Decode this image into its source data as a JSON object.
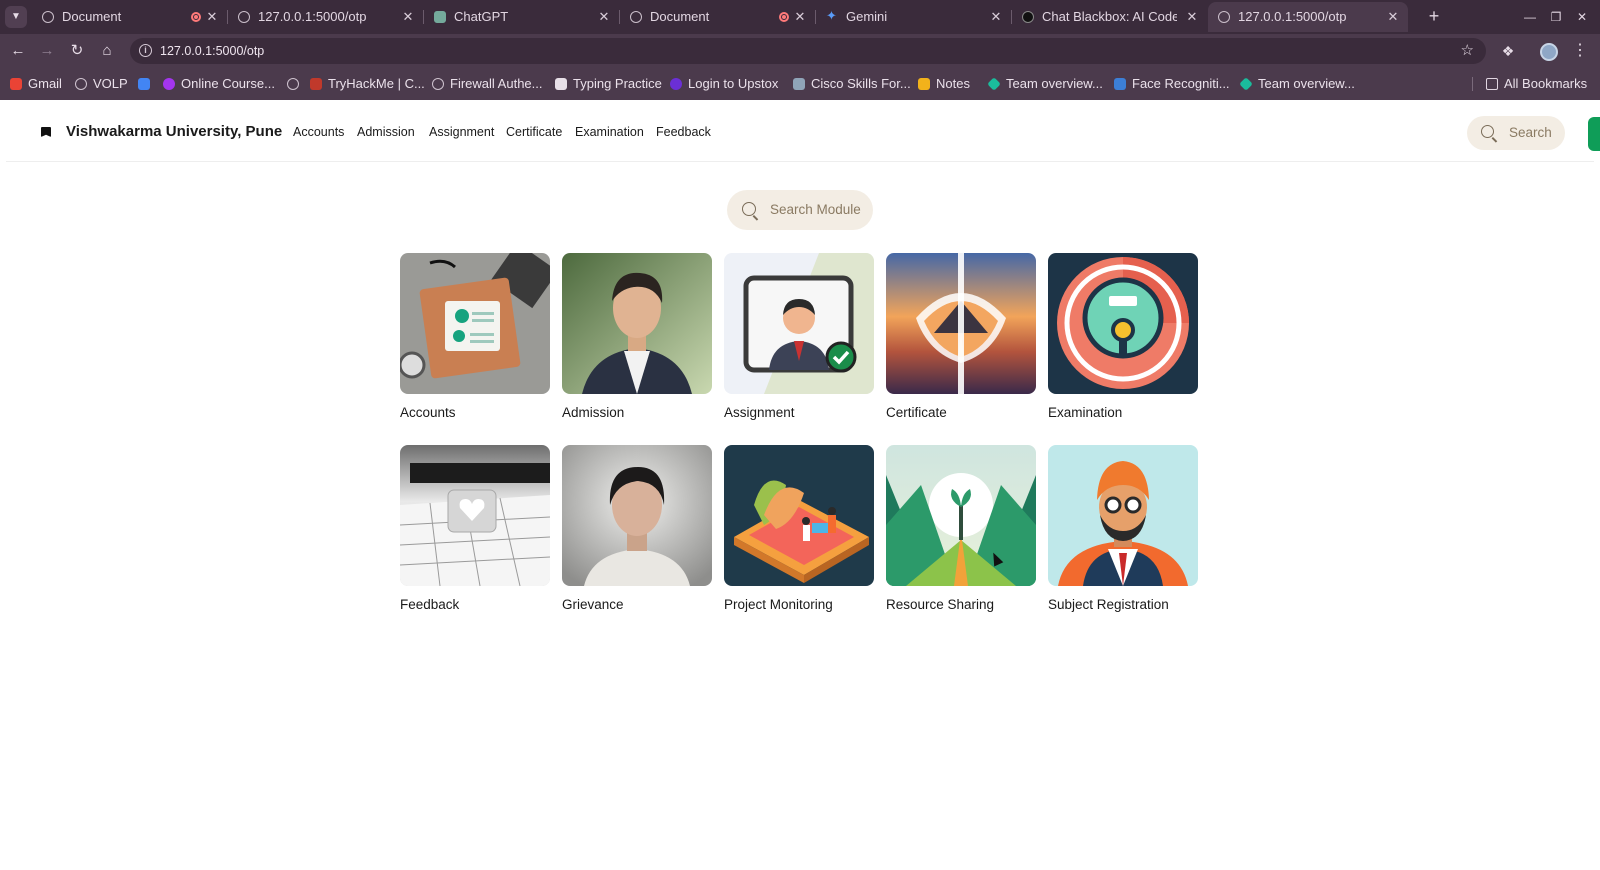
{
  "browser": {
    "tabs": [
      {
        "title": "Document",
        "recording": true
      },
      {
        "title": "127.0.0.1:5000/otp",
        "recording": false
      },
      {
        "title": "ChatGPT",
        "recording": false
      },
      {
        "title": "Document",
        "recording": true
      },
      {
        "title": "Gemini",
        "recording": false
      },
      {
        "title": "Chat Blackbox: AI Code G",
        "recording": false
      },
      {
        "title": "127.0.0.1:5000/otp",
        "recording": false,
        "active": true
      }
    ],
    "new_tab_label": "+",
    "address": "127.0.0.1:5000/otp",
    "bookmarks": [
      {
        "label": "Gmail",
        "icon": "gmail-icon",
        "color": "#ea4335"
      },
      {
        "label": "VOLP",
        "icon": "globe-icon",
        "color": "#cfc3cf"
      },
      {
        "label": "",
        "icon": "bookmark-icon",
        "color": "#4285f4"
      },
      {
        "label": "Online Course...",
        "icon": "udemy-icon",
        "color": "#a435f0"
      },
      {
        "label": "",
        "icon": "globe-icon",
        "color": "#cfc3cf"
      },
      {
        "label": "TryHackMe | C...",
        "icon": "tryhackme-icon",
        "color": "#c0392b"
      },
      {
        "label": "Firewall Authe...",
        "icon": "globe-icon",
        "color": "#cfc3cf"
      },
      {
        "label": "Typing Practice",
        "icon": "keyboard-icon",
        "color": "#e8e0e8"
      },
      {
        "label": "Login to Upstox",
        "icon": "upstox-icon",
        "color": "#6b2fd6"
      },
      {
        "label": "Cisco Skills For...",
        "icon": "cisco-icon",
        "color": "#8fa4b8"
      },
      {
        "label": "Notes",
        "icon": "notes-icon",
        "color": "#f2b21b"
      },
      {
        "label": "Team overview...",
        "icon": "diamond-icon",
        "color": "#1abc9c"
      },
      {
        "label": "Face Recogniti...",
        "icon": "face-recognition-icon",
        "color": "#3c7fd6"
      },
      {
        "label": "Team overview...",
        "icon": "diamond-icon",
        "color": "#1abc9c"
      }
    ],
    "all_bookmarks_label": "All Bookmarks"
  },
  "site": {
    "brand": "Vishwakarma University, Pune",
    "nav_links": [
      "Accounts",
      "Admission",
      "Assignment",
      "Certificate",
      "Examination",
      "Feedback"
    ],
    "search_label": "Search",
    "accent_color": "#0f9d58"
  },
  "main": {
    "search_placeholder": "Search Module",
    "modules": [
      {
        "label": "Accounts",
        "image": "accounts-illustration"
      },
      {
        "label": "Admission",
        "image": "admission-portrait"
      },
      {
        "label": "Assignment",
        "image": "assignment-illustration"
      },
      {
        "label": "Certificate",
        "image": "certificate-illustration"
      },
      {
        "label": "Examination",
        "image": "examination-illustration"
      },
      {
        "label": "Feedback",
        "image": "feedback-illustration"
      },
      {
        "label": "Grievance",
        "image": "grievance-portrait"
      },
      {
        "label": "Project Monitoring",
        "image": "project-monitoring-illustration"
      },
      {
        "label": "Resource Sharing",
        "image": "resource-sharing-illustration"
      },
      {
        "label": "Subject Registration",
        "image": "subject-registration-illustration"
      }
    ]
  }
}
